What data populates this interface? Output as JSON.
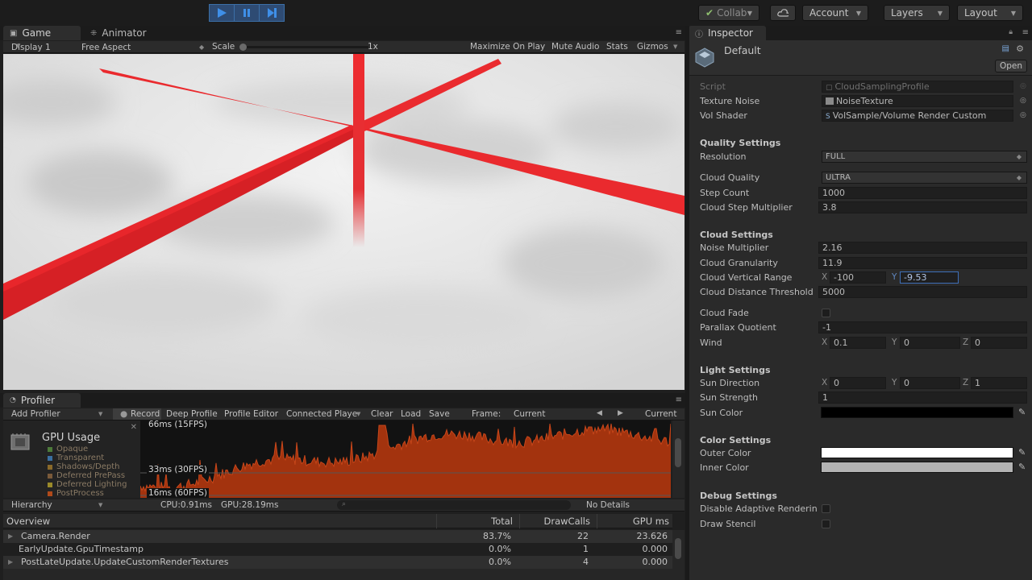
{
  "toolbar": {
    "collab_label": "Collab",
    "account_label": "Account",
    "layers_label": "Layers",
    "layout_label": "Layout"
  },
  "game_panel": {
    "tabs": [
      {
        "label": "Game"
      },
      {
        "label": "Animator"
      }
    ],
    "display": "Display 1",
    "aspect": "Free Aspect",
    "scale_label": "Scale",
    "scale_value": "1x",
    "maximize_on_play": "Maximize On Play",
    "mute_audio": "Mute Audio",
    "stats": "Stats",
    "gizmos": "Gizmos"
  },
  "profiler": {
    "tab_label": "Profiler",
    "add_profiler": "Add Profiler",
    "record": "Record",
    "deep_profile": "Deep Profile",
    "profile_editor": "Profile Editor",
    "connected_player": "Connected Playe",
    "clear": "Clear",
    "load": "Load",
    "save": "Save",
    "frame_label": "Frame:",
    "frame_value": "Current",
    "current_button": "Current",
    "gpu_usage_title": "GPU Usage",
    "legend": [
      {
        "label": "Opaque",
        "color": "#4d7a3a"
      },
      {
        "label": "Transparent",
        "color": "#3a6fa0"
      },
      {
        "label": "Shadows/Depth",
        "color": "#8a6a2a"
      },
      {
        "label": "Deferred PrePass",
        "color": "#7a5a3a"
      },
      {
        "label": "Deferred Lighting",
        "color": "#9a8a2a"
      },
      {
        "label": "PostProcess",
        "color": "#b04a1a"
      }
    ],
    "grid_labels": [
      "66ms (15FPS)",
      "33ms (30FPS)",
      "16ms (60FPS)"
    ],
    "hierarchy_label": "Hierarchy",
    "cpu_time": "CPU:0.91ms",
    "gpu_time": "GPU:28.19ms",
    "no_details": "No Details",
    "columns": [
      "Overview",
      "Total",
      "DrawCalls",
      "GPU ms"
    ],
    "rows": [
      {
        "name": "Camera.Render",
        "total": "83.7%",
        "drawcalls": "22",
        "gpu": "23.626"
      },
      {
        "name": "EarlyUpdate.GpuTimestamp",
        "total": "0.0%",
        "drawcalls": "1",
        "gpu": "0.000"
      },
      {
        "name": "PostLateUpdate.UpdateCustomRenderTextures",
        "total": "0.0%",
        "drawcalls": "4",
        "gpu": "0.000"
      }
    ]
  },
  "inspector": {
    "tab_label": "Inspector",
    "object_name": "Default",
    "open_button": "Open",
    "script_label": "Script",
    "script_value": "CloudSamplingProfile",
    "texture_noise_label": "Texture Noise",
    "texture_noise_value": "NoiseTexture",
    "vol_shader_label": "Vol Shader",
    "vol_shader_value": "VolSample/Volume Render Custom",
    "quality_header": "Quality Settings",
    "resolution_label": "Resolution",
    "resolution_value": "FULL",
    "cloud_quality_label": "Cloud Quality",
    "cloud_quality_value": "ULTRA",
    "step_count_label": "Step Count",
    "step_count_value": "1000",
    "step_mult_label": "Cloud Step Multiplier",
    "step_mult_value": "3.8",
    "cloud_header": "Cloud Settings",
    "noise_mult_label": "Noise Multiplier",
    "noise_mult_value": "2.16",
    "granularity_label": "Cloud Granularity",
    "granularity_value": "11.9",
    "vertical_range_label": "Cloud Vertical Range",
    "vertical_range_x": "-100",
    "vertical_range_y": "-9.53",
    "distance_label": "Cloud Distance Threshold",
    "distance_value": "5000",
    "cloud_fade_label": "Cloud Fade",
    "parallax_label": "Parallax Quotient",
    "parallax_value": "-1",
    "wind_label": "Wind",
    "wind_x": "0.1",
    "wind_y": "0",
    "wind_z": "0",
    "light_header": "Light Settings",
    "sun_dir_label": "Sun Direction",
    "sun_dir_x": "0",
    "sun_dir_y": "0",
    "sun_dir_z": "1",
    "sun_strength_label": "Sun Strength",
    "sun_strength_value": "1",
    "sun_color_label": "Sun Color",
    "sun_color": "#000000",
    "color_header": "Color Settings",
    "outer_color_label": "Outer Color",
    "outer_color": "#ffffff",
    "inner_color_label": "Inner Color",
    "inner_color": "#b3b3b3",
    "debug_header": "Debug Settings",
    "disable_adaptive_label": "Disable Adaptive Renderin",
    "draw_stencil_label": "Draw Stencil",
    "axis_x": "X",
    "axis_y": "Y",
    "axis_z": "Z"
  }
}
